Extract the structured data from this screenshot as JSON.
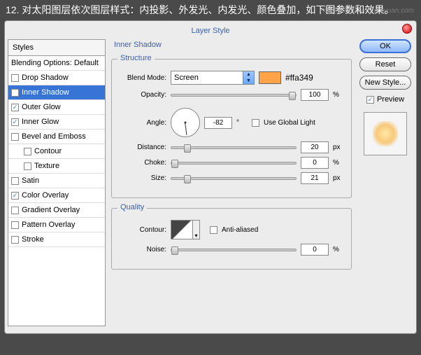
{
  "header_text": "12. 对太阳图层依次图层样式：内投影、外发光、内发光、颜色叠加，如下图参数和效果。",
  "watermark": "缘设计源 www.missyuan.com",
  "dialog": {
    "title": "Layer Style"
  },
  "styles_panel": {
    "header": "Styles",
    "blending": "Blending Options: Default",
    "items": [
      {
        "label": "Drop Shadow",
        "checked": false,
        "selected": false
      },
      {
        "label": "Inner Shadow",
        "checked": true,
        "selected": true
      },
      {
        "label": "Outer Glow",
        "checked": true,
        "selected": false
      },
      {
        "label": "Inner Glow",
        "checked": true,
        "selected": false
      },
      {
        "label": "Bevel and Emboss",
        "checked": false,
        "selected": false
      },
      {
        "label": "Contour",
        "checked": false,
        "selected": false,
        "sub": true
      },
      {
        "label": "Texture",
        "checked": false,
        "selected": false,
        "sub": true
      },
      {
        "label": "Satin",
        "checked": false,
        "selected": false
      },
      {
        "label": "Color Overlay",
        "checked": true,
        "selected": false
      },
      {
        "label": "Gradient Overlay",
        "checked": false,
        "selected": false
      },
      {
        "label": "Pattern Overlay",
        "checked": false,
        "selected": false
      },
      {
        "label": "Stroke",
        "checked": false,
        "selected": false
      }
    ]
  },
  "center": {
    "title": "Inner Shadow",
    "structure": {
      "legend": "Structure",
      "blend_mode_label": "Blend Mode:",
      "blend_mode_value": "Screen",
      "color_hex": "#ffa349",
      "opacity_label": "Opacity:",
      "opacity_value": "100",
      "opacity_unit": "%",
      "angle_label": "Angle:",
      "angle_value": "-82",
      "angle_unit": "°",
      "global_light_label": "Use Global Light",
      "distance_label": "Distance:",
      "distance_value": "20",
      "distance_unit": "px",
      "choke_label": "Choke:",
      "choke_value": "0",
      "choke_unit": "%",
      "size_label": "Size:",
      "size_value": "21",
      "size_unit": "px"
    },
    "quality": {
      "legend": "Quality",
      "contour_label": "Contour:",
      "anti_aliased_label": "Anti-aliased",
      "noise_label": "Noise:",
      "noise_value": "0",
      "noise_unit": "%"
    }
  },
  "right": {
    "ok": "OK",
    "reset": "Reset",
    "new_style": "New Style...",
    "preview": "Preview"
  }
}
